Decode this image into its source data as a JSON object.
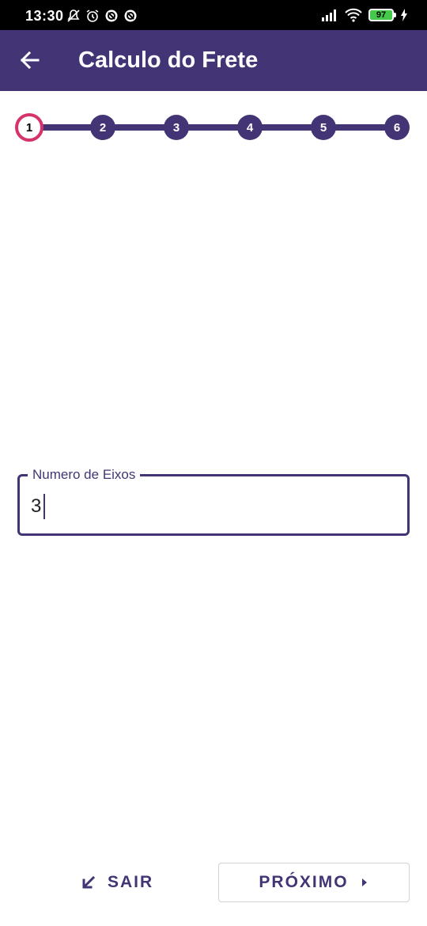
{
  "status_bar": {
    "time": "13:30",
    "battery": "97",
    "icons": [
      "notifications-off-icon",
      "alarm-icon",
      "at-sign-icon",
      "at-sign-icon",
      "signal-icon",
      "wifi-icon",
      "battery-icon",
      "charging-icon"
    ]
  },
  "app_bar": {
    "title": "Calculo do Frete",
    "back_icon": "arrow-left-icon",
    "color": "#433575"
  },
  "stepper": {
    "steps": [
      "1",
      "2",
      "3",
      "4",
      "5",
      "6"
    ],
    "active_step": "1",
    "active_ring_color": "#d6336c"
  },
  "form": {
    "axles_label": "Numero de Eixos",
    "axles_value": "3"
  },
  "actions": {
    "exit_label": "SAIR",
    "exit_icon": "arrow-down-left-icon",
    "next_label": "PRÓXIMO",
    "next_icon": "caret-right-icon"
  }
}
